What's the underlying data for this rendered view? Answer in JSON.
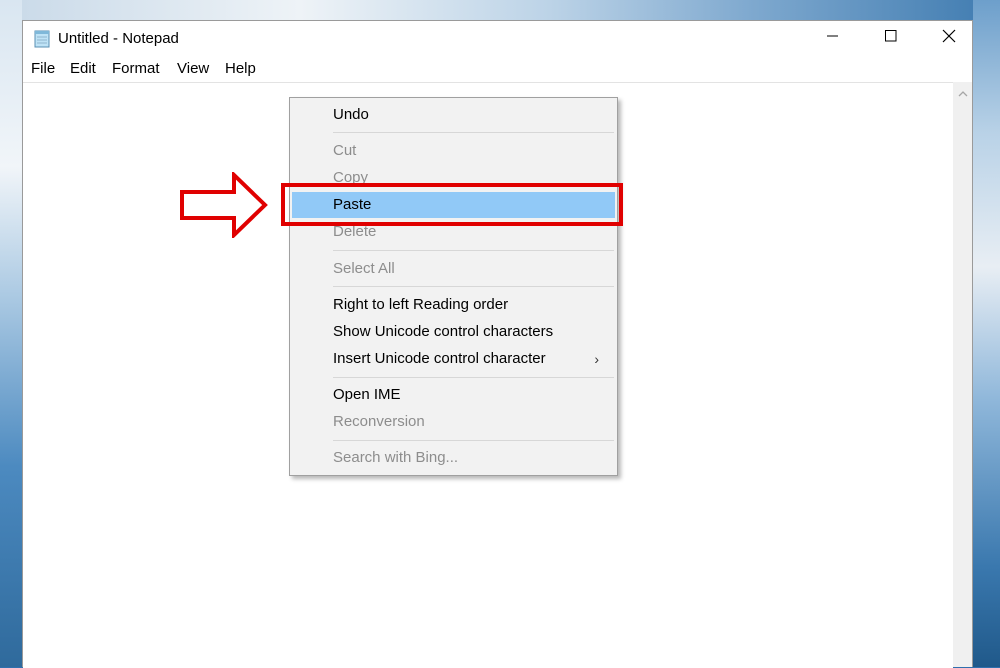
{
  "window": {
    "title": "Untitled - Notepad",
    "icon": "notepad-icon",
    "controls": [
      "minimize-icon",
      "maximize-icon",
      "close-icon"
    ]
  },
  "menubar": {
    "items": [
      "File",
      "Edit",
      "Format",
      "View",
      "Help"
    ]
  },
  "context_menu": {
    "items": [
      {
        "label": "Undo",
        "enabled": true
      },
      {
        "label": "Cut",
        "enabled": false
      },
      {
        "label": "Copy",
        "enabled": false
      },
      {
        "label": "Paste",
        "enabled": true,
        "highlighted": true
      },
      {
        "label": "Delete",
        "enabled": false
      },
      {
        "label": "Select All",
        "enabled": false
      },
      {
        "label": "Right to left Reading order",
        "enabled": true
      },
      {
        "label": "Show Unicode control characters",
        "enabled": true
      },
      {
        "label": "Insert Unicode control character",
        "enabled": true,
        "submenu": true
      },
      {
        "label": "Open IME",
        "enabled": true
      },
      {
        "label": "Reconversion",
        "enabled": false
      },
      {
        "label": "Search with Bing...",
        "enabled": false
      }
    ],
    "submenu_arrow": "›"
  },
  "annotation": {
    "color": "#e00000",
    "arrow": "right-arrow-outline",
    "target": "Paste"
  },
  "colors": {
    "highlight": "#91c9f7",
    "disabled_text": "#8d8d8d"
  }
}
